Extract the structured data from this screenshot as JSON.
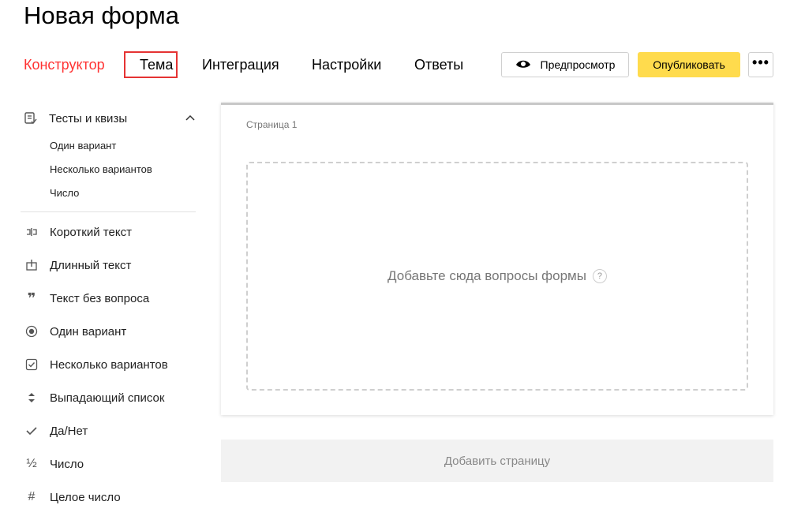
{
  "header": {
    "title": "Новая форма"
  },
  "tabs": [
    {
      "label": "Конструктор",
      "active": true
    },
    {
      "label": "Тема",
      "highlighted": true
    },
    {
      "label": "Интеграция"
    },
    {
      "label": "Настройки"
    },
    {
      "label": "Ответы"
    }
  ],
  "toolbar": {
    "preview_label": "Предпросмотр",
    "preview_icon": "eye-icon",
    "publish_label": "Опубликовать",
    "more_label": "•••"
  },
  "colors": {
    "active_tab": "#ff3333",
    "highlight_box": "#e53333",
    "publish_bg": "#ffdb4d"
  },
  "sidebar": {
    "group": {
      "label": "Тесты и квизы",
      "icon": "quiz-icon",
      "expanded": true,
      "items": [
        "Один вариант",
        "Несколько вариантов",
        "Число"
      ]
    },
    "items": [
      {
        "label": "Короткий текст",
        "icon": "short-text-icon"
      },
      {
        "label": "Длинный текст",
        "icon": "long-text-icon"
      },
      {
        "label": "Текст без вопроса",
        "icon": "quote-icon"
      },
      {
        "label": "Один вариант",
        "icon": "radio-icon"
      },
      {
        "label": "Несколько вариантов",
        "icon": "checkbox-icon"
      },
      {
        "label": "Выпадающий список",
        "icon": "dropdown-icon"
      },
      {
        "label": "Да/Нет",
        "icon": "check-icon"
      },
      {
        "label": "Число",
        "icon": "fraction-icon"
      },
      {
        "label": "Целое число",
        "icon": "hash-icon"
      }
    ]
  },
  "main": {
    "page_label": "Страница 1",
    "drop_text": "Добавьте сюда вопросы формы",
    "help_icon": "?",
    "add_page_label": "Добавить страницу"
  }
}
